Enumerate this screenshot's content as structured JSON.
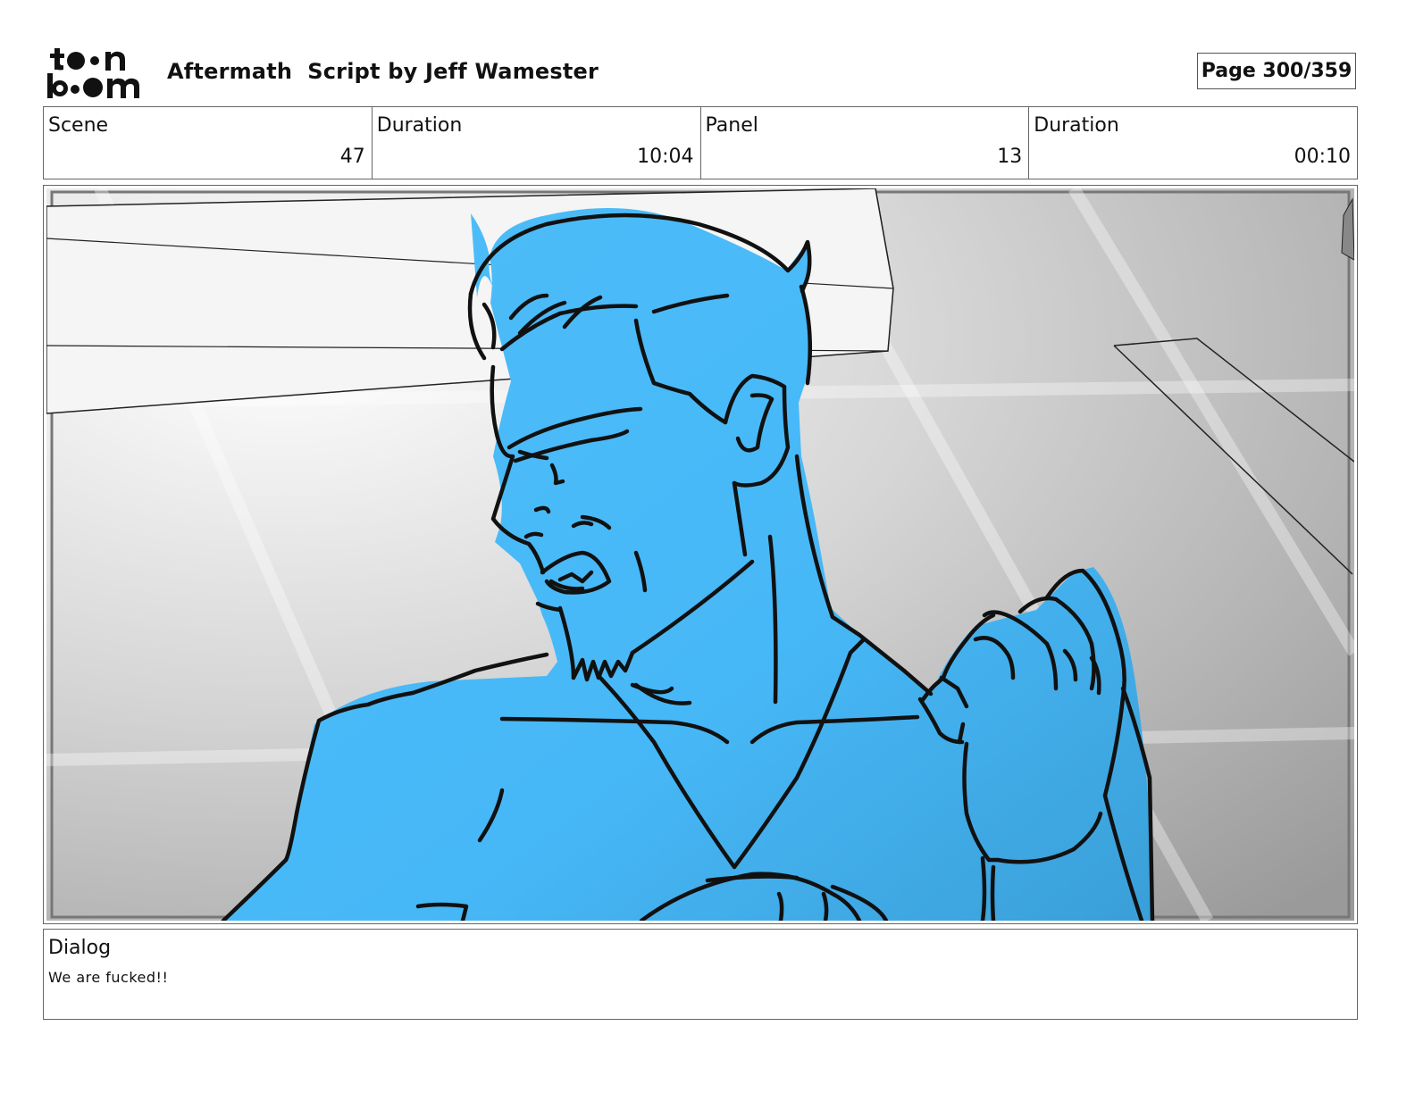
{
  "header": {
    "logo_text": "toonboom",
    "title": "Aftermath  Script by Jeff Wamester",
    "page": "Page 300/359"
  },
  "info": {
    "scene_label": "Scene",
    "scene_value": "47",
    "scene_duration_label": "Duration",
    "scene_duration_value": "10:04",
    "panel_label": "Panel",
    "panel_value": "13",
    "panel_duration_label": "Duration",
    "panel_duration_value": "00:10"
  },
  "panel": {
    "description": "",
    "fill_color": "#47b8f7",
    "line_color": "#111111",
    "background_color": "#cfcfcf"
  },
  "dialog": {
    "label": "Dialog",
    "text": "We are fucked!!"
  }
}
